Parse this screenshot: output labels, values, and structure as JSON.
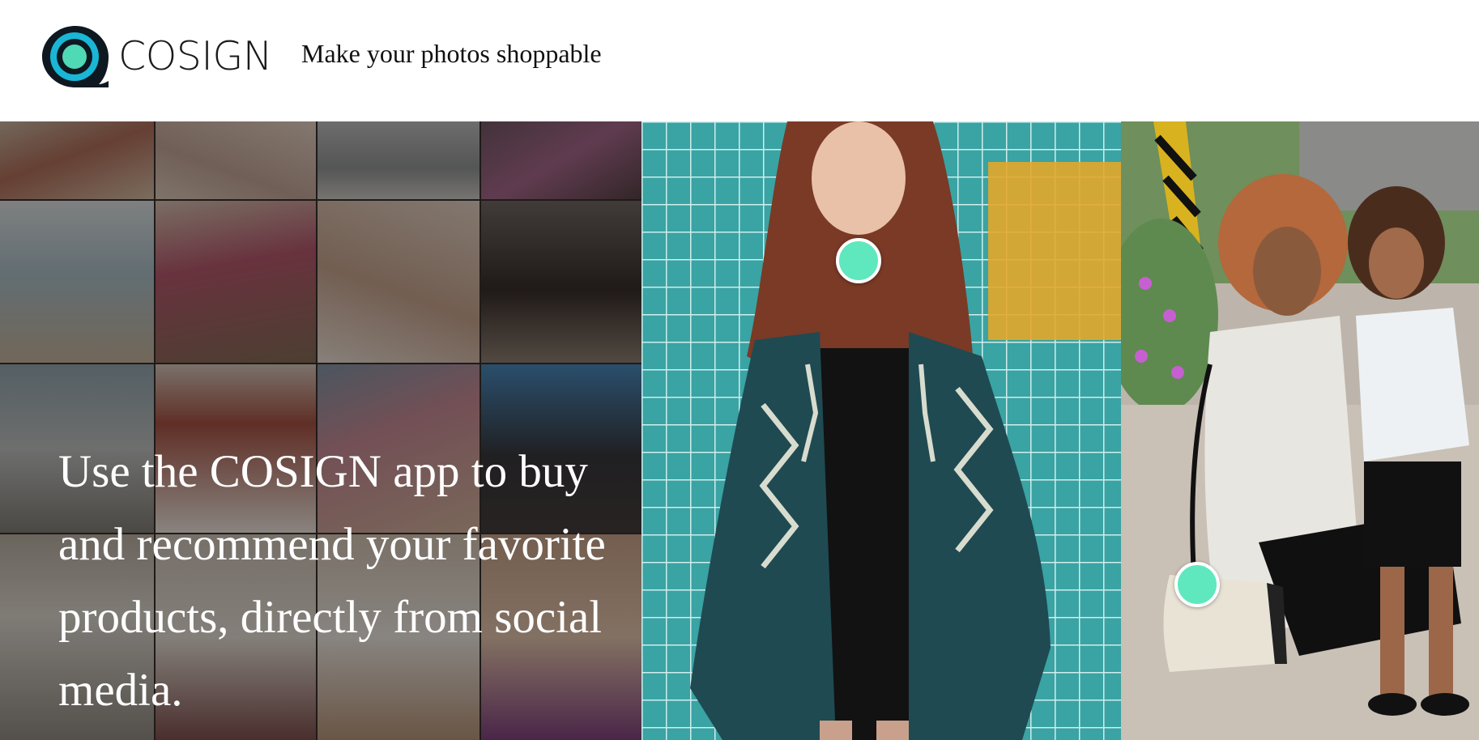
{
  "header": {
    "logo_text": "COSIGN",
    "tagline": "Make your photos shoppable"
  },
  "hero": {
    "headline": "Use the COSIGN app to buy and recommend your favorite products, directly from social media."
  },
  "icons": {
    "logo": "cosign-eye-logo-icon",
    "hotspot": "shoppable-hotspot-dot"
  },
  "colors": {
    "accent": "#5fe8bd",
    "logo_outer": "#0e1820",
    "logo_ring": "#1ab6d6",
    "logo_inner": "#4fd9b4"
  }
}
